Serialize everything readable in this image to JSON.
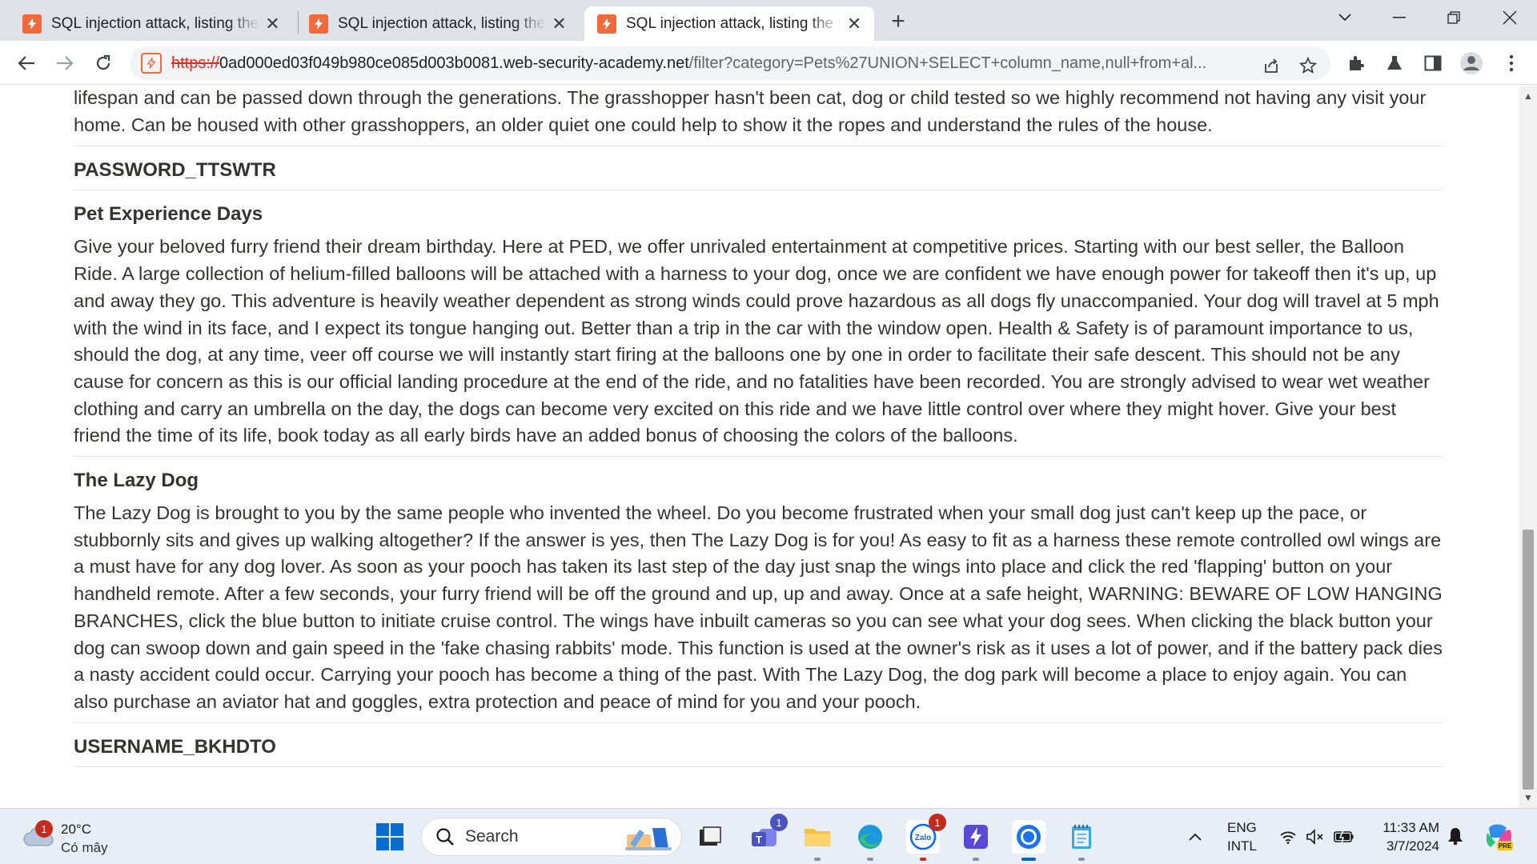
{
  "browser": {
    "tabs": [
      {
        "title": "SQL injection attack, listing the database contents on non-Oracle databases",
        "active": false
      },
      {
        "title": "SQL injection attack, listing the database contents on non-Oracle databases",
        "active": false
      },
      {
        "title": "SQL injection attack, listing the database contents on non-Oracle databases",
        "active": true
      }
    ],
    "url_scheme": "https://",
    "url_host": "0ad000ed03f049b980ce085d003b0081.web-security-academy.net",
    "url_path": "/filter?category=Pets%27UNION+SELECT+column_name,null+from+al...",
    "accent_color": "#f26a3c"
  },
  "page": {
    "top_description": "lifespan and can be passed down through the generations. The grasshopper hasn't been cat, dog or child tested so we highly recommend not having any visit your home. Can be housed with other grasshoppers, an older quiet one could help to show it the ropes and understand the rules of the house.",
    "entries": [
      {
        "heading": "PASSWORD_TTSWTR",
        "description": ""
      },
      {
        "heading": "Pet Experience Days",
        "description": "Give your beloved furry friend their dream birthday. Here at PED, we offer unrivaled entertainment at competitive prices. Starting with our best seller, the Balloon Ride. A large collection of helium-filled balloons will be attached with a harness to your dog, once we are confident we have enough power for takeoff then it's up, up and away they go. This adventure is heavily weather dependent as strong winds could prove hazardous as all dogs fly unaccompanied. Your dog will travel at 5 mph with the wind in its face, and I expect its tongue hanging out. Better than a trip in the car with the window open. Health & Safety is of paramount importance to us, should the dog, at any time, veer off course we will instantly start firing at the balloons one by one in order to facilitate their safe descent. This should not be any cause for concern as this is our official landing procedure at the end of the ride, and no fatalities have been recorded. You are strongly advised to wear wet weather clothing and carry an umbrella on the day, the dogs can become very excited on this ride and we have little control over where they might hover. Give your best friend the time of its life, book today as all early birds have an added bonus of choosing the colors of the balloons."
      },
      {
        "heading": "The Lazy Dog",
        "description": "The Lazy Dog is brought to you by the same people who invented the wheel. Do you become frustrated when your small dog just can't keep up the pace, or stubbornly sits and gives up walking altogether? If the answer is yes, then The Lazy Dog is for you! As easy to fit as a harness these remote controlled owl wings are a must have for any dog lover. As soon as your pooch has taken its last step of the day just snap the wings into place and click the red 'flapping' button on your handheld remote. After a few seconds, your furry friend will be off the ground and up, up and away. Once at a safe height, WARNING: BEWARE OF LOW HANGING BRANCHES, click the blue button to initiate cruise control. The wings have inbuilt cameras so you can see what your dog sees. When clicking the black button your dog can swoop down and gain speed in the 'fake chasing rabbits' mode. This function is used at the owner's risk as it uses a lot of power, and if the battery pack dies a nasty accident could occur. Carrying your pooch has become a thing of the past. With The Lazy Dog, the dog park will become a place to enjoy again. You can also purchase an aviator hat and goggles, extra protection and peace of mind for you and your pooch."
      },
      {
        "heading": "USERNAME_BKHDTO",
        "description": ""
      }
    ]
  },
  "taskbar": {
    "weather_temp": "20°C",
    "weather_condition": "Có mây",
    "weather_badge": "1",
    "search_label": "Search",
    "teams_badge": "1",
    "zalo_badge": "1",
    "zalo_label": "Zalo",
    "lang_line1": "ENG",
    "lang_line2": "INTL",
    "time": "11:33 AM",
    "date": "3/7/2024",
    "copilot_label": "PRE"
  }
}
